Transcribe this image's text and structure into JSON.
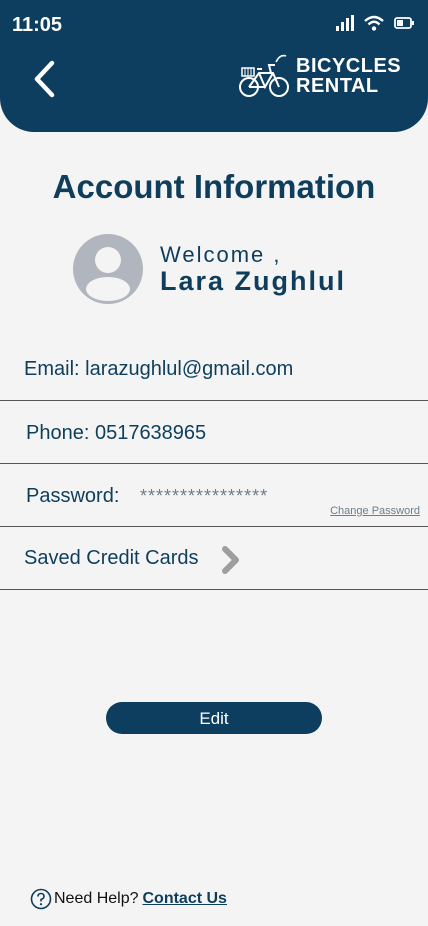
{
  "status": {
    "time": "11:05"
  },
  "brand": {
    "line1": "BICYCLES",
    "line2": "RENTAL"
  },
  "page": {
    "title": "Account Information"
  },
  "user": {
    "welcome": "Welcome ,",
    "name": "Lara Zughlul"
  },
  "fields": {
    "email": "Email: larazughlul@gmail.com",
    "phone": "Phone: 0517638965",
    "password_label": "Password:",
    "password_value": "****************",
    "change_password": "Change Password",
    "saved_cards": "Saved Credit Cards"
  },
  "actions": {
    "edit": "Edit"
  },
  "help": {
    "prompt": "Need Help?",
    "contact": "Contact Us"
  },
  "colors": {
    "primary": "#0d3e5f",
    "background": "#f4f4f4",
    "avatar": "#b1b5bd"
  }
}
